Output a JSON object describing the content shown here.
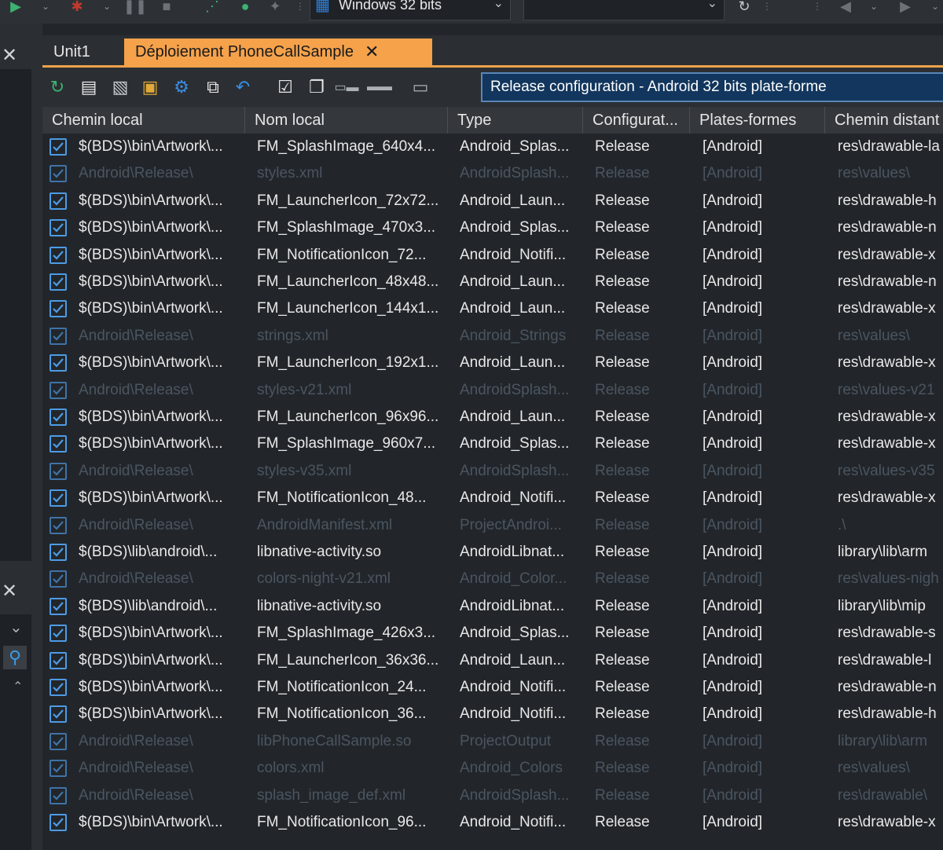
{
  "toolbar_top": {
    "platform_combo": "Windows 32 bits",
    "second_combo": ""
  },
  "tabs": [
    {
      "label": "Unit1",
      "active": false
    },
    {
      "label": "Déploiement PhoneCallSample",
      "active": true
    }
  ],
  "deploy_toolbar": {
    "icons": [
      "refresh-icon",
      "add-files-icon",
      "remove-files-icon",
      "add-feature-files-icon",
      "connect-icon",
      "deploy-icon",
      "revert-icon",
      "select-all-icon",
      "unselect-icon",
      "collapse-icon",
      "expand-icon",
      "folder-icon"
    ],
    "configuration": "Release configuration - Android 32 bits plate-forme"
  },
  "columns": [
    "Chemin local",
    "Nom local",
    "Type",
    "Configurat...",
    "Plates-formes",
    "Chemin distant"
  ],
  "rows": [
    {
      "dim": false,
      "local_path": "$(BDS)\\bin\\Artwork\\...",
      "local_name": "FM_SplashImage_640x4...",
      "type": "Android_Splas...",
      "config": "Release",
      "platforms": "[Android]",
      "remote_path": "res\\drawable-la"
    },
    {
      "dim": true,
      "local_path": "Android\\Release\\",
      "local_name": "styles.xml",
      "type": "AndroidSplash...",
      "config": "Release",
      "platforms": "[Android]",
      "remote_path": "res\\values\\"
    },
    {
      "dim": false,
      "local_path": "$(BDS)\\bin\\Artwork\\...",
      "local_name": "FM_LauncherIcon_72x72...",
      "type": "Android_Laun...",
      "config": "Release",
      "platforms": "[Android]",
      "remote_path": "res\\drawable-h"
    },
    {
      "dim": false,
      "local_path": "$(BDS)\\bin\\Artwork\\...",
      "local_name": "FM_SplashImage_470x3...",
      "type": "Android_Splas...",
      "config": "Release",
      "platforms": "[Android]",
      "remote_path": "res\\drawable-n"
    },
    {
      "dim": false,
      "local_path": "$(BDS)\\bin\\Artwork\\...",
      "local_name": "FM_NotificationIcon_72...",
      "type": "Android_Notifi...",
      "config": "Release",
      "platforms": "[Android]",
      "remote_path": "res\\drawable-x"
    },
    {
      "dim": false,
      "local_path": "$(BDS)\\bin\\Artwork\\...",
      "local_name": "FM_LauncherIcon_48x48...",
      "type": "Android_Laun...",
      "config": "Release",
      "platforms": "[Android]",
      "remote_path": "res\\drawable-n"
    },
    {
      "dim": false,
      "local_path": "$(BDS)\\bin\\Artwork\\...",
      "local_name": "FM_LauncherIcon_144x1...",
      "type": "Android_Laun...",
      "config": "Release",
      "platforms": "[Android]",
      "remote_path": "res\\drawable-x"
    },
    {
      "dim": true,
      "local_path": "Android\\Release\\",
      "local_name": "strings.xml",
      "type": "Android_Strings",
      "config": "Release",
      "platforms": "[Android]",
      "remote_path": "res\\values\\"
    },
    {
      "dim": false,
      "local_path": "$(BDS)\\bin\\Artwork\\...",
      "local_name": "FM_LauncherIcon_192x1...",
      "type": "Android_Laun...",
      "config": "Release",
      "platforms": "[Android]",
      "remote_path": "res\\drawable-x"
    },
    {
      "dim": true,
      "local_path": "Android\\Release\\",
      "local_name": "styles-v21.xml",
      "type": "AndroidSplash...",
      "config": "Release",
      "platforms": "[Android]",
      "remote_path": "res\\values-v21"
    },
    {
      "dim": false,
      "local_path": "$(BDS)\\bin\\Artwork\\...",
      "local_name": "FM_LauncherIcon_96x96...",
      "type": "Android_Laun...",
      "config": "Release",
      "platforms": "[Android]",
      "remote_path": "res\\drawable-x"
    },
    {
      "dim": false,
      "local_path": "$(BDS)\\bin\\Artwork\\...",
      "local_name": "FM_SplashImage_960x7...",
      "type": "Android_Splas...",
      "config": "Release",
      "platforms": "[Android]",
      "remote_path": "res\\drawable-x"
    },
    {
      "dim": true,
      "local_path": "Android\\Release\\",
      "local_name": "styles-v35.xml",
      "type": "AndroidSplash...",
      "config": "Release",
      "platforms": "[Android]",
      "remote_path": "res\\values-v35"
    },
    {
      "dim": false,
      "local_path": "$(BDS)\\bin\\Artwork\\...",
      "local_name": "FM_NotificationIcon_48...",
      "type": "Android_Notifi...",
      "config": "Release",
      "platforms": "[Android]",
      "remote_path": "res\\drawable-x"
    },
    {
      "dim": true,
      "local_path": "Android\\Release\\",
      "local_name": "AndroidManifest.xml",
      "type": "ProjectAndroi...",
      "config": "Release",
      "platforms": "[Android]",
      "remote_path": ".\\"
    },
    {
      "dim": false,
      "local_path": "$(BDS)\\lib\\android\\...",
      "local_name": "libnative-activity.so",
      "type": "AndroidLibnat...",
      "config": "Release",
      "platforms": "[Android]",
      "remote_path": "library\\lib\\arm"
    },
    {
      "dim": true,
      "local_path": "Android\\Release\\",
      "local_name": "colors-night-v21.xml",
      "type": "Android_Color...",
      "config": "Release",
      "platforms": "[Android]",
      "remote_path": "res\\values-nigh"
    },
    {
      "dim": false,
      "local_path": "$(BDS)\\lib\\android\\...",
      "local_name": "libnative-activity.so",
      "type": "AndroidLibnat...",
      "config": "Release",
      "platforms": "[Android]",
      "remote_path": "library\\lib\\mip"
    },
    {
      "dim": false,
      "local_path": "$(BDS)\\bin\\Artwork\\...",
      "local_name": "FM_SplashImage_426x3...",
      "type": "Android_Splas...",
      "config": "Release",
      "platforms": "[Android]",
      "remote_path": "res\\drawable-s"
    },
    {
      "dim": false,
      "local_path": "$(BDS)\\bin\\Artwork\\...",
      "local_name": "FM_LauncherIcon_36x36...",
      "type": "Android_Laun...",
      "config": "Release",
      "platforms": "[Android]",
      "remote_path": "res\\drawable-l"
    },
    {
      "dim": false,
      "local_path": "$(BDS)\\bin\\Artwork\\...",
      "local_name": "FM_NotificationIcon_24...",
      "type": "Android_Notifi...",
      "config": "Release",
      "platforms": "[Android]",
      "remote_path": "res\\drawable-n"
    },
    {
      "dim": false,
      "local_path": "$(BDS)\\bin\\Artwork\\...",
      "local_name": "FM_NotificationIcon_36...",
      "type": "Android_Notifi...",
      "config": "Release",
      "platforms": "[Android]",
      "remote_path": "res\\drawable-h"
    },
    {
      "dim": true,
      "local_path": "Android\\Release\\",
      "local_name": "libPhoneCallSample.so",
      "type": "ProjectOutput",
      "config": "Release",
      "platforms": "[Android]",
      "remote_path": "library\\lib\\arm"
    },
    {
      "dim": true,
      "local_path": "Android\\Release\\",
      "local_name": "colors.xml",
      "type": "Android_Colors",
      "config": "Release",
      "platforms": "[Android]",
      "remote_path": "res\\values\\"
    },
    {
      "dim": true,
      "local_path": "Android\\Release\\",
      "local_name": "splash_image_def.xml",
      "type": "AndroidSplash...",
      "config": "Release",
      "platforms": "[Android]",
      "remote_path": "res\\drawable\\"
    },
    {
      "dim": false,
      "local_path": "$(BDS)\\bin\\Artwork\\...",
      "local_name": "FM_NotificationIcon_96...",
      "type": "Android_Notifi...",
      "config": "Release",
      "platforms": "[Android]",
      "remote_path": "res\\drawable-x"
    }
  ],
  "colors": {
    "accent_tab": "#f5a24b",
    "config_bg": "#12365d",
    "checkbox": "#4d9be6",
    "dim_text": "#4b5560"
  }
}
